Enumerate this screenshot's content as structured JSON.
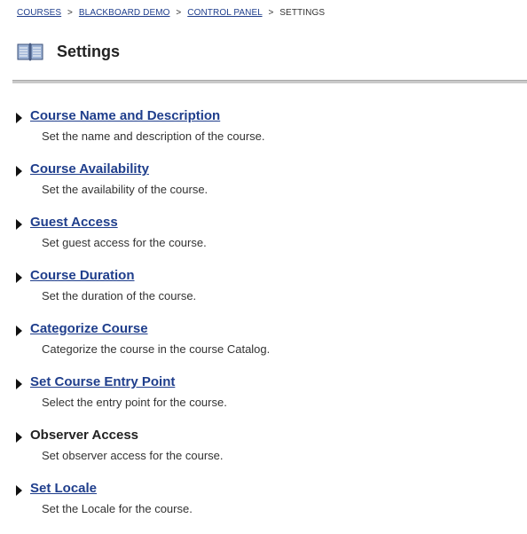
{
  "breadcrumb": {
    "courses": "COURSES",
    "course": "BLACKBOARD DEMO",
    "control_panel": "CONTROL PANEL",
    "current": "SETTINGS",
    "separator": ">"
  },
  "header": {
    "icon": "book-icon",
    "title": "Settings"
  },
  "items": [
    {
      "label": "Course Name and Description",
      "description": "Set the name and description of the course.",
      "link": true
    },
    {
      "label": "Course Availability",
      "description": "Set the availability of the course.",
      "link": true
    },
    {
      "label": "Guest Access",
      "description": "Set guest access for the course.",
      "link": true
    },
    {
      "label": "Course Duration",
      "description": "Set the duration of the course.",
      "link": true
    },
    {
      "label": "Categorize Course",
      "description": "Categorize the course in the course Catalog.",
      "link": true
    },
    {
      "label": "Set Course Entry Point",
      "description": "Select the entry point for the course.",
      "link": true
    },
    {
      "label": "Observer Access",
      "description": "Set observer access for the course.",
      "link": false
    },
    {
      "label": "Set Locale",
      "description": "Set the Locale for the course.",
      "link": true
    }
  ],
  "colors": {
    "link": "#1f3e8c",
    "text": "#222222",
    "divider": "#c9c9c9"
  }
}
